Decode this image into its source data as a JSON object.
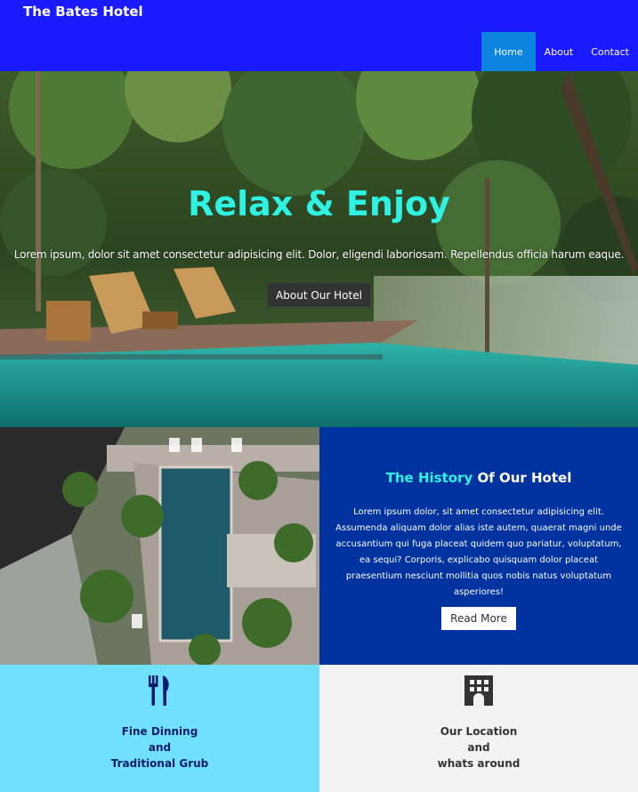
{
  "brand": "The Bates Hotel",
  "nav": {
    "items": [
      "Home",
      "About",
      "Contact"
    ],
    "active": "Home"
  },
  "hero": {
    "title": "Relax & Enjoy",
    "text": "Lorem ipsum, dolor sit amet consectetur adipisicing elit. Dolor, eligendi laboriosam. Repellendus officia harum eaque.",
    "button": "About Our Hotel"
  },
  "history": {
    "title_highlight": "The History",
    "title_rest": " Of Our Hotel",
    "body": "Lorem ipsum dolor, sit amet consectetur adipisicing elit. Assumenda aliquam dolor alias iste autem, quaerat magni unde accusantium qui fuga placeat quidem quo pariatur, voluptatum, ea sequi? Corporis, explicabo quisquam dolor placeat praesentium nesciunt mollitia quos nobis natus voluptatum asperiores!",
    "button": "Read More"
  },
  "features": [
    {
      "icon": "utensils-icon",
      "lines": [
        "Fine Dinning",
        "and",
        "Traditional Grub"
      ]
    },
    {
      "icon": "building-icon",
      "lines": [
        "Our Location",
        "and",
        "whats around"
      ]
    }
  ],
  "colors": {
    "header": "#1a1aff",
    "nav_active": "#0b84e0",
    "accent_cyan": "#2ef2e2",
    "history_panel": "#0033a0",
    "card_left": "#71e0ff",
    "card_right": "#f2f2f2"
  }
}
